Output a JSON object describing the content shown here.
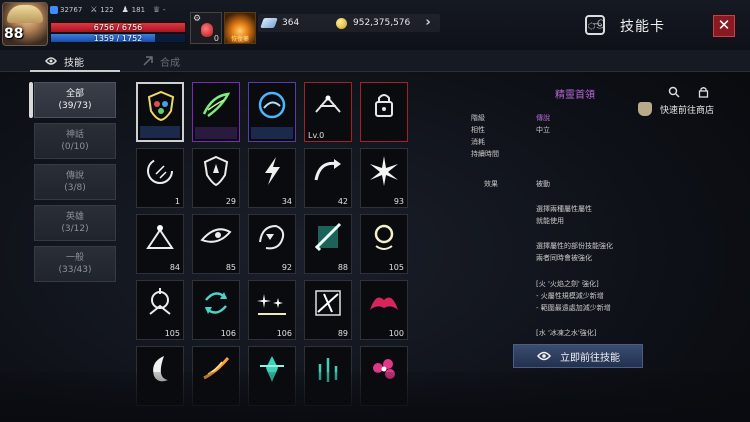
{
  "player": {
    "level": "88",
    "power": "32767",
    "stat2": "122",
    "stat3": "181",
    "stat4": "-",
    "hp_text": "6756 / 6756",
    "mp_text": "1359 / 1752",
    "hp_fraction": 1.0,
    "mp_fraction": 0.776
  },
  "potion": {
    "count": "0"
  },
  "skill_slot": {
    "label": "恢復藥"
  },
  "currency": {
    "diamonds": "364",
    "gold": "952,375,576"
  },
  "header": {
    "title": "技能卡",
    "close": "✕"
  },
  "tabs": [
    {
      "label": "技能"
    },
    {
      "label": "合成"
    }
  ],
  "shop_link": {
    "label": "快速前往商店"
  },
  "categories": [
    {
      "name": "全部",
      "count": "(39/73)"
    },
    {
      "name": "神話",
      "count": "(0/10)"
    },
    {
      "name": "傳說",
      "count": "(3/8)"
    },
    {
      "name": "英雄",
      "count": "(3/12)"
    },
    {
      "name": "一般",
      "count": "(33/43)"
    }
  ],
  "grid": [
    [
      {
        "count": ""
      },
      {
        "count": ""
      },
      {
        "count": ""
      },
      {
        "count": "Lv.0"
      },
      {
        "count": ""
      }
    ],
    [
      {
        "count": "1"
      },
      {
        "count": "29"
      },
      {
        "count": "34"
      },
      {
        "count": "42"
      },
      {
        "count": "93"
      }
    ],
    [
      {
        "count": "84"
      },
      {
        "count": "85"
      },
      {
        "count": "92"
      },
      {
        "count": "88"
      },
      {
        "count": "105"
      }
    ],
    [
      {
        "count": "105"
      },
      {
        "count": "106"
      },
      {
        "count": "106"
      },
      {
        "count": "89"
      },
      {
        "count": "100"
      }
    ],
    [
      {
        "count": ""
      },
      {
        "count": ""
      },
      {
        "count": ""
      },
      {
        "count": ""
      },
      {
        "count": ""
      }
    ]
  ],
  "detail": {
    "name": "精靈首領",
    "rows": [
      {
        "label": "階級",
        "value": "傳說"
      },
      {
        "label": "相性",
        "value": "中立"
      },
      {
        "label": "消耗",
        "value": ""
      },
      {
        "label": "持續時間",
        "value": ""
      }
    ],
    "effect_label": "效果",
    "effect_value": "被動",
    "lines": [
      "選擇兩種屬性屬性",
      "就能使用",
      "選擇屬性的部份技能強化",
      "兩者同時會被強化",
      "[火 '火焰之劍' 強化]",
      "- 火屬性規模減少新增",
      "- 範圍最遠處加減少新增",
      "[水 '冰凍之水'強化]"
    ],
    "go_button": "立即前往技能"
  }
}
